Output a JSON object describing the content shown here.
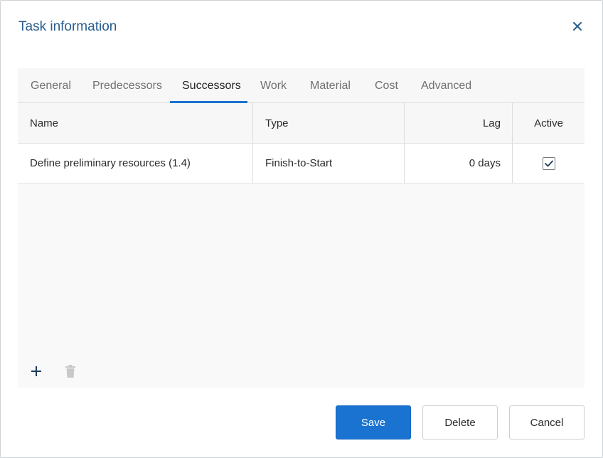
{
  "dialog": {
    "title": "Task information",
    "close_icon": "close-icon"
  },
  "tabs": [
    {
      "label": "General",
      "active": false
    },
    {
      "label": "Predecessors",
      "active": false
    },
    {
      "label": "Successors",
      "active": true
    },
    {
      "label": "Work",
      "active": false
    },
    {
      "label": "Material",
      "active": false
    },
    {
      "label": "Cost",
      "active": false
    },
    {
      "label": "Advanced",
      "active": false
    }
  ],
  "grid": {
    "columns": {
      "name": "Name",
      "type": "Type",
      "lag": "Lag",
      "active": "Active"
    },
    "rows": [
      {
        "name": "Define preliminary resources (1.4)",
        "type": "Finish-to-Start",
        "lag": "0 days",
        "active": true
      }
    ],
    "toolbar": {
      "add_icon": "plus-icon",
      "delete_icon": "trash-icon"
    }
  },
  "footer": {
    "save_label": "Save",
    "delete_label": "Delete",
    "cancel_label": "Cancel"
  },
  "colors": {
    "accent": "#1a73d0",
    "title": "#2a5d8f"
  }
}
